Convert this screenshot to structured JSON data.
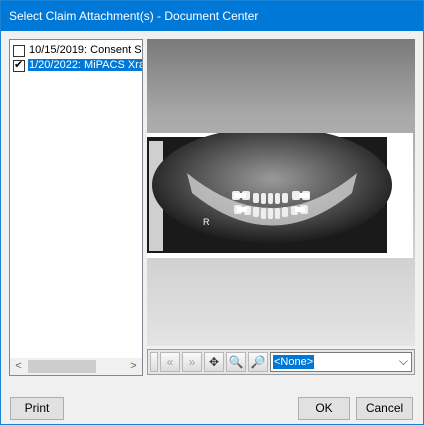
{
  "window": {
    "title": "Select Claim Attachment(s) - Document Center"
  },
  "file_list": {
    "items": [
      {
        "label": "10/15/2019: Consent S",
        "checked": false,
        "selected": false
      },
      {
        "label": "1/20/2022: MiPACS Xra",
        "checked": true,
        "selected": true
      }
    ],
    "scroll_left_glyph": "<",
    "scroll_right_glyph": ">"
  },
  "viewer": {
    "image_marker": "R"
  },
  "toolbar": {
    "buttons": [
      {
        "icon": "first-page-icon",
        "glyph": "⏮",
        "enabled": false
      },
      {
        "icon": "previous-page-icon",
        "glyph": "«",
        "enabled": false
      },
      {
        "icon": "next-page-icon",
        "glyph": "»",
        "enabled": false
      },
      {
        "icon": "fit-to-window-icon",
        "glyph": "✥",
        "enabled": true
      },
      {
        "icon": "zoom-out-icon",
        "glyph": "🔍",
        "enabled": true
      },
      {
        "icon": "zoom-in-icon",
        "glyph": "🔎",
        "enabled": true
      }
    ],
    "page_select": {
      "value": "<None>",
      "arrow": "⌵"
    }
  },
  "buttons": {
    "print": "Print",
    "ok": "OK",
    "cancel": "Cancel"
  }
}
